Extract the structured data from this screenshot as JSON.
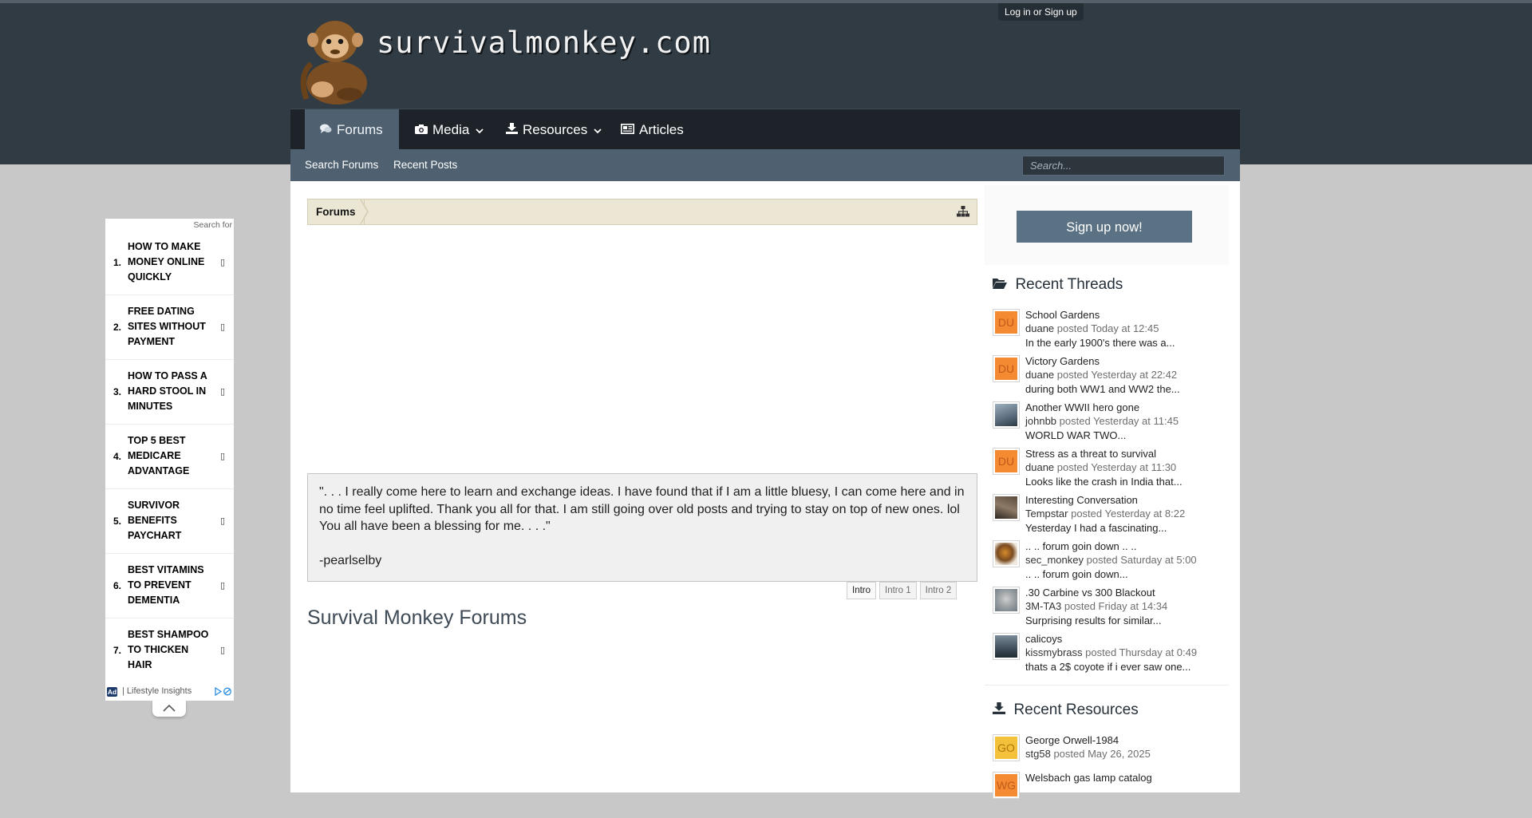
{
  "header": {
    "login_label": "Log in or Sign up",
    "site_name": "survivalmonkey.com",
    "logo_icon": "monkey-logo-icon"
  },
  "nav": {
    "tabs": [
      {
        "label": "Forums",
        "icon": "comments-icon",
        "active": true
      },
      {
        "label": "Media",
        "icon": "camera-icon",
        "dropdown": true
      },
      {
        "label": "Resources",
        "icon": "download-icon",
        "dropdown": true
      },
      {
        "label": "Articles",
        "icon": "newspaper-icon"
      }
    ],
    "subnav": [
      "Search Forums",
      "Recent Posts"
    ],
    "search_placeholder": "Search..."
  },
  "breadcrumb": {
    "items": [
      "Forums"
    ],
    "sitemap_icon": "sitemap-icon"
  },
  "intro": {
    "quote": "\". . . I really come here to learn and exchange ideas. I have found that if I am a little bluesy, I can come here and in no time feel uplifted. Thank you all for that. I am still going over old posts and trying to stay on top of new ones. lol You all have been a blessing for me. . . .\"",
    "author": "-pearlselby",
    "tabs": [
      "Intro",
      "Intro 1",
      "Intro 2"
    ],
    "active_tab": "Intro"
  },
  "main": {
    "heading": "Survival Monkey Forums"
  },
  "sidebar": {
    "signup_label": "Sign up now!",
    "recent_threads_title": "Recent Threads",
    "recent_threads": [
      {
        "title": "School Gardens",
        "user": "duane",
        "posted": "posted Today at 12:45",
        "snippet": "In the early 1900's there was a...",
        "avatar": "DU"
      },
      {
        "title": "Victory Gardens",
        "user": "duane",
        "posted": "posted Yesterday at 22:42",
        "snippet": "during both WW1 and WW2 the...",
        "avatar": "DU"
      },
      {
        "title": "Another WWII hero gone",
        "user": "johnbb",
        "posted": "posted Yesterday at 11:45",
        "snippet": "WORLD WAR TWO...",
        "avatar": ""
      },
      {
        "title": "Stress as a threat to survival",
        "user": "duane",
        "posted": "posted Yesterday at 11:30",
        "snippet": "Looks like the crash in India that...",
        "avatar": "DU"
      },
      {
        "title": "Interesting Conversation",
        "user": "Tempstar",
        "posted": "posted Yesterday at 8:22",
        "snippet": "Yesterday I had a fascinating...",
        "avatar": ""
      },
      {
        "title": ".. .. forum goin down .. ..",
        "user": "sec_monkey",
        "posted": "posted Saturday at 5:00",
        "snippet": ".. .. forum goin down...",
        "avatar": ""
      },
      {
        "title": ".30 Carbine vs 300 Blackout",
        "user": "3M-TA3",
        "posted": "posted Friday at 14:34",
        "snippet": "Surprising results for similar...",
        "avatar": ""
      },
      {
        "title": "calicoys",
        "user": "kissmybrass",
        "posted": "posted Thursday at 0:49",
        "snippet": "thats a 2$ coyote if i ever saw one...",
        "avatar": ""
      }
    ],
    "recent_resources_title": "Recent Resources",
    "recent_resources": [
      {
        "title": "George Orwell-1984",
        "user": "stg58",
        "posted": "posted May 26, 2025",
        "avatar": "GO"
      },
      {
        "title": "Welsbach gas lamp catalog",
        "user": "",
        "posted": "",
        "avatar": "WG"
      }
    ]
  },
  "ad": {
    "search_for": "Search for",
    "items": [
      {
        "num": "1.",
        "text": "How to Make Money Online Quickly"
      },
      {
        "num": "2.",
        "text": "Free Dating Sites Without Payment"
      },
      {
        "num": "3.",
        "text": "How to Pass a Hard Stool in Minutes"
      },
      {
        "num": "4.",
        "text": "Top 5 Best Medicare Advantage"
      },
      {
        "num": "5.",
        "text": "Survivor Benefits Paychart"
      },
      {
        "num": "6.",
        "text": "Best Vitamins to Prevent Dementia"
      },
      {
        "num": "7.",
        "text": "Best Shampoo to Thicken Hair"
      }
    ],
    "badge": "Ad",
    "source": "| Lifestyle Insights",
    "arrow_glyph": "▯"
  },
  "colors": {
    "header_bg": "#303b44",
    "nav_bg": "#1d2329",
    "accent": "#4f6171",
    "signup": "#5b7285",
    "breadcrumb_bg": "#ece7d5",
    "avatar_orange": "#f48b32"
  }
}
